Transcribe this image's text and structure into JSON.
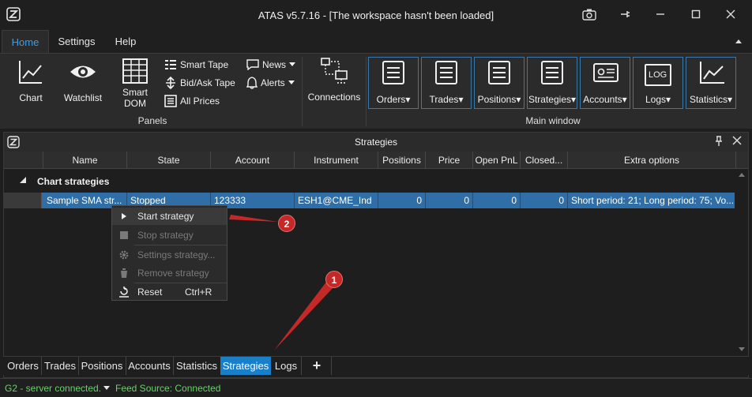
{
  "window": {
    "title": "ATAS v5.7.16 - [The workspace hasn't been loaded]"
  },
  "ribbon_tabs": [
    "Home",
    "Settings",
    "Help"
  ],
  "panels": {
    "chart": "Chart",
    "watchlist": "Watchlist",
    "smart_dom": "Smart DOM",
    "smart_tape": "Smart Tape",
    "bid_ask_tape": "Bid/Ask Tape",
    "all_prices": "All Prices",
    "news": "News",
    "alerts": "Alerts",
    "connections": "Connections",
    "group_label": "Panels"
  },
  "main_window": {
    "buttons": [
      "Orders",
      "Trades",
      "Positions",
      "Strategies",
      "Accounts",
      "Logs",
      "Statistics"
    ],
    "group_label": "Main window",
    "log_text": "LOG"
  },
  "strategies_panel": {
    "title": "Strategies",
    "columns": [
      "Name",
      "State",
      "Account",
      "Instrument",
      "Positions",
      "Price",
      "Open PnL",
      "Closed...",
      "Extra options"
    ],
    "group": "Chart strategies",
    "rows": [
      {
        "name": "Sample SMA str...",
        "state": "Stopped",
        "account": "123333",
        "instrument": "ESH1@CME_Ind",
        "positions": "0",
        "price": "0",
        "open_pnl": "0",
        "closed": "0",
        "extra": "Short period: 21; Long period: 75; Vo..."
      }
    ]
  },
  "context_menu": {
    "start": "Start strategy",
    "stop": "Stop strategy",
    "settings": "Settings strategy...",
    "remove": "Remove strategy",
    "reset": "Reset",
    "reset_shortcut": "Ctrl+R"
  },
  "annotations": {
    "badge1": "1",
    "badge2": "2",
    "color": "#c62828"
  },
  "bottom_tabs": [
    "Orders",
    "Trades",
    "Positions",
    "Accounts",
    "Statistics",
    "Strategies",
    "Logs"
  ],
  "add_tab": "+",
  "status": {
    "server": "G2 - server connected.",
    "feed": "Feed Source: Connected"
  },
  "colors": {
    "accent": "#1a7fc9",
    "selection": "#2f6ea6",
    "status_ok": "#6bd06b"
  }
}
